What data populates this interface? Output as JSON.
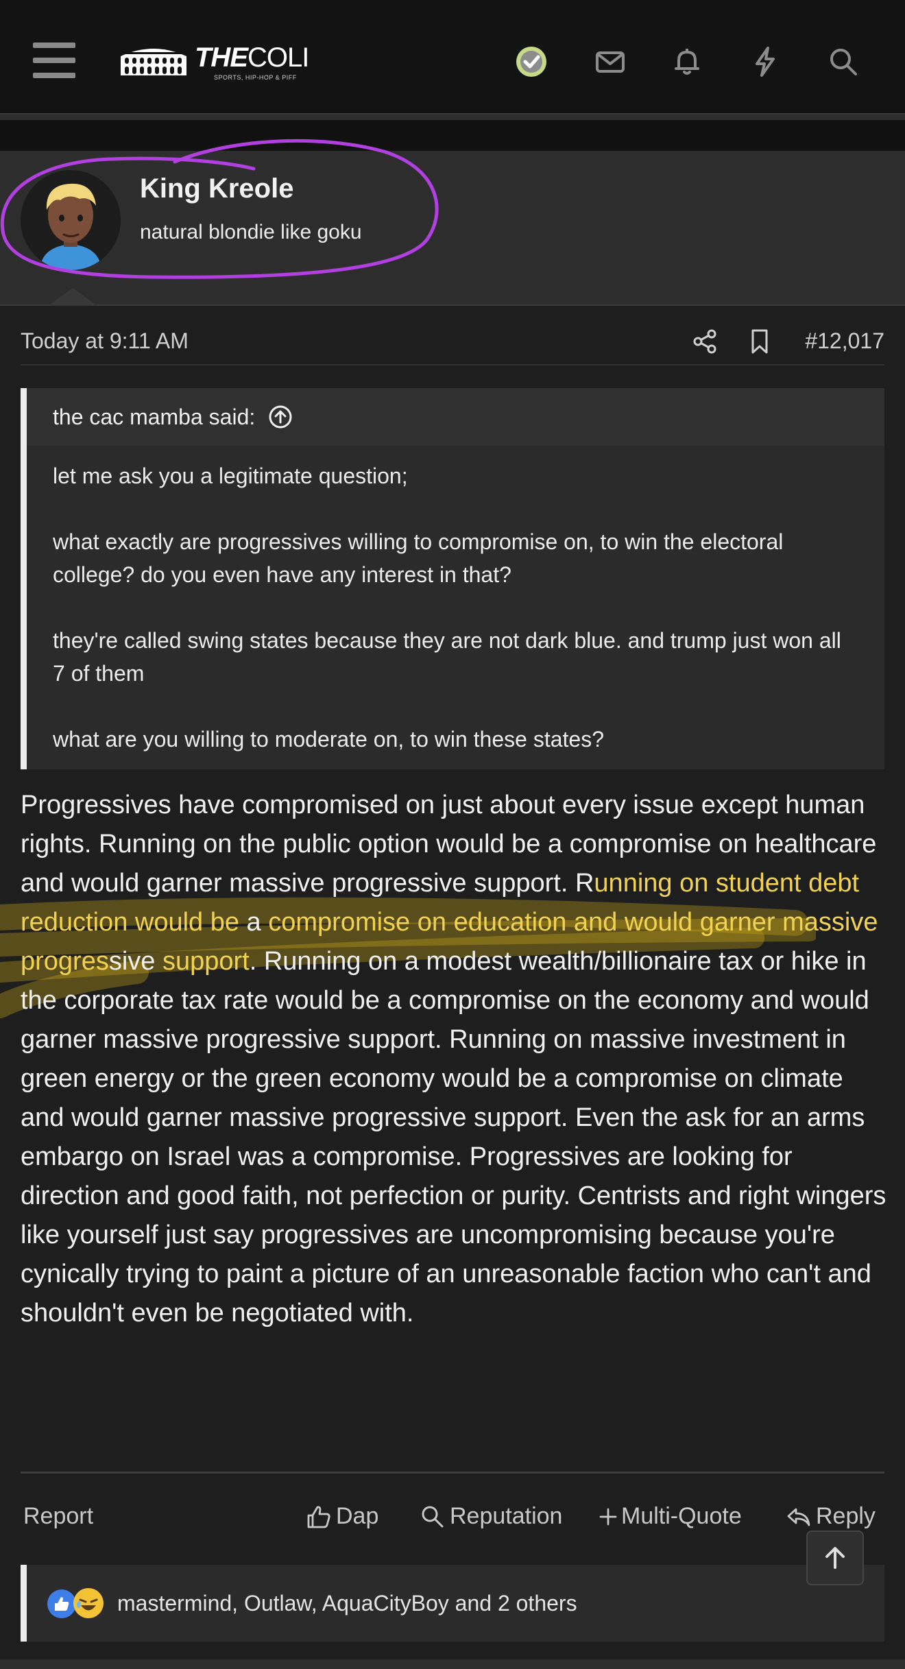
{
  "app": {
    "logo_title_bold": "THE",
    "logo_title_rest": "COLI",
    "logo_subtitle": "SPORTS, HIP-HOP & PIFF"
  },
  "nav": {
    "icons": [
      "check-icon",
      "envelope-icon",
      "bell-icon",
      "lightning-icon",
      "search-icon"
    ]
  },
  "user": {
    "name": "King Kreole",
    "title": "natural blondie like goku"
  },
  "post": {
    "date": "Today at 9:11 AM",
    "number": "#12,017",
    "quote": {
      "author": "the cac mamba said:",
      "paragraphs": [
        "let me ask you a legitimate question;",
        "what exactly are progressives willing to compromise on, to win the electoral college? do you even have any interest in that?",
        "they're called swing states because they are not dark blue. and trump just won all 7 of them",
        "what are you willing to moderate on, to win these states?"
      ]
    },
    "body": {
      "part1": "Progressives have compromised on just about every issue except human rights. Running on the public option would be a compromise on healthcare and would garner massive progressive support. R",
      "highlight1": "unning on student debt reduction would be",
      "part2": " a ",
      "highlight2": "compromise on education and would garner massive progres",
      "part3": "sive ",
      "highlight3": "support",
      "part4": ". Running on a modest wealth/billionaire tax or hike in the corporate tax rate would be a compromise on the economy and would garner massive progressive support. Running on massive investment in green energy or the green economy would be a compromise on climate and would garner massive progressive support. Even the ask for an arms embargo on Israel was a compromise. Progressives are looking for direction and good faith, not perfection or purity. Centrists and right wingers like yourself just say progressives are uncompromising because you're cynically trying to paint a picture of an unreasonable faction who can't and shouldn't even be negotiated with."
    },
    "actions": {
      "report": "Report",
      "dap": "Dap",
      "reputation": "Reputation",
      "multi_quote": "Multi-Quote",
      "reply": "Reply"
    },
    "reactions": {
      "text": "mastermind, Outlaw, AquaCityBoy and 2 others"
    }
  },
  "colors": {
    "background": "#1e1e1e",
    "highlight_text": "#f1d252",
    "annotation_ring": "#b23fe0",
    "scribble": "#d8b118",
    "check_badge": "#c9d98a"
  }
}
